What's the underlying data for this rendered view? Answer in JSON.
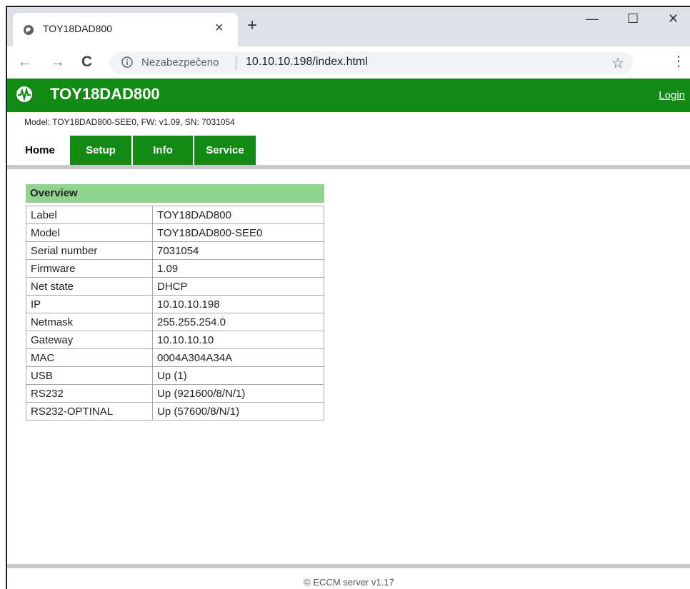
{
  "browser": {
    "tab_title": "TOY18DAD800",
    "tab_close": "×",
    "new_tab": "+",
    "minimize": "—",
    "maximize": "☐",
    "close": "✕",
    "back": "←",
    "forward": "→",
    "reload": "C",
    "security_label": "Nezabezpečeno",
    "url": "10.10.10.198/index.html",
    "bookmark": "☆",
    "menu": "⋮"
  },
  "header": {
    "brand": "TOY18DAD800",
    "login": "Login",
    "model_line": "Model: TOY18DAD800-SEE0, FW: v1.09, SN: 7031054"
  },
  "tabs": [
    {
      "label": "Home"
    },
    {
      "label": "Setup"
    },
    {
      "label": "Info"
    },
    {
      "label": "Service"
    }
  ],
  "overview": {
    "title": "Overview",
    "rows": [
      {
        "key": "Label",
        "value": "TOY18DAD800"
      },
      {
        "key": "Model",
        "value": "TOY18DAD800-SEE0"
      },
      {
        "key": "Serial number",
        "value": "7031054"
      },
      {
        "key": "Firmware",
        "value": "1.09"
      },
      {
        "key": "Net state",
        "value": "DHCP"
      },
      {
        "key": "IP",
        "value": "10.10.10.198"
      },
      {
        "key": "Netmask",
        "value": "255.255.254.0"
      },
      {
        "key": "Gateway",
        "value": "10.10.10.10"
      },
      {
        "key": "MAC",
        "value": "0004A304A34A"
      },
      {
        "key": "USB",
        "value": "Up (1)"
      },
      {
        "key": "RS232",
        "value": "Up (921600/8/N/1)"
      },
      {
        "key": "RS232-OPTINAL",
        "value": "Up (57600/8/N/1)"
      }
    ]
  },
  "footer": "© ECCM server v1.17",
  "colors": {
    "header_green": "#138a13",
    "overview_green": "#8ed48e"
  }
}
